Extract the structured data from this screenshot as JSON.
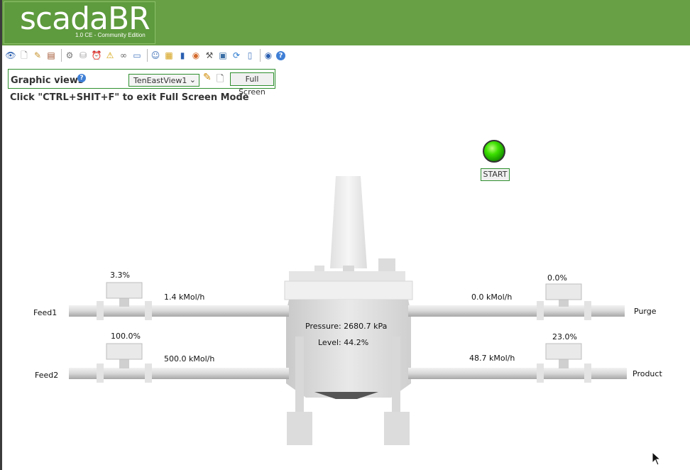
{
  "header": {
    "logo_text": "scadaBR",
    "logo_subtitle": "1.0 CE - Community Edition",
    "brand_color": "#68a046"
  },
  "toolbar": {
    "icons": [
      "watch-list-icon",
      "new-page-icon",
      "edit-page-icon",
      "report-icon",
      "settings-gear-icon",
      "database-icon",
      "clock-icon",
      "alarm-icon",
      "link-icon",
      "script-icon",
      "users-icon",
      "folder-icon",
      "book-icon",
      "radio-icon",
      "tools-icon",
      "import-export-icon",
      "sync-icon",
      "document-icon",
      "stop-icon",
      "help-icon"
    ]
  },
  "graphic_views": {
    "title": "Graphic views",
    "selected_view": "TenEastView1",
    "fullscreen_label": "Full Screen",
    "hint": "Click \"CTRL+SHIT+F\" to exit Full Screen Mode"
  },
  "start": {
    "label": "START",
    "status_color": "#3ce000"
  },
  "process": {
    "feed1": {
      "name": "Feed1",
      "valve": "3.3%",
      "flow": "1.4 kMol/h"
    },
    "feed2": {
      "name": "Feed2",
      "valve": "100.0%",
      "flow": "500.0 kMol/h"
    },
    "purge": {
      "name": "Purge",
      "valve": "0.0%",
      "flow": "0.0 kMol/h"
    },
    "product": {
      "name": "Product",
      "valve": "23.0%",
      "flow": "48.7 kMol/h"
    },
    "tank": {
      "pressure": "Pressure: 2680.7 kPa",
      "level": "Level: 44.2%"
    }
  }
}
